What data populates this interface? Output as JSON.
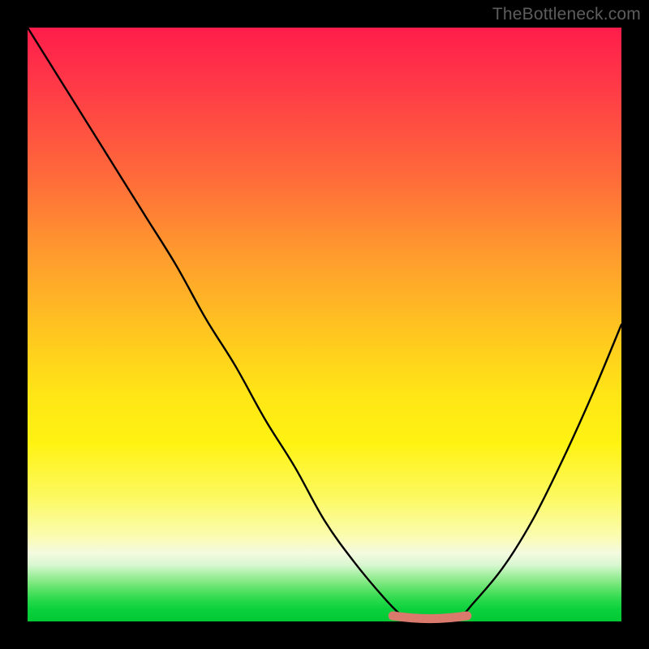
{
  "watermark": "TheBottleneck.com",
  "colors": {
    "frame": "#000000",
    "curve": "#000000",
    "marker": "#d97a6d",
    "gradient_top": "#ff1d4b",
    "gradient_bottom": "#00c934"
  },
  "chart_data": {
    "type": "line",
    "title": "",
    "xlabel": "",
    "ylabel": "",
    "xlim": [
      0,
      100
    ],
    "ylim": [
      0,
      100
    ],
    "series": [
      {
        "name": "bottleneck-curve",
        "x": [
          0,
          5,
          10,
          15,
          20,
          25,
          30,
          35,
          40,
          45,
          50,
          55,
          60,
          63,
          65,
          67,
          70,
          73,
          75,
          80,
          85,
          90,
          95,
          100
        ],
        "values": [
          100,
          92,
          84,
          76,
          68,
          60,
          51,
          43,
          34,
          26,
          17,
          10,
          4,
          1,
          0,
          0,
          0,
          1,
          3,
          9,
          17,
          27,
          38,
          50
        ]
      }
    ],
    "flat_minimum_segment": {
      "x_start": 61.5,
      "x_end": 74,
      "y": 0.8
    },
    "annotations": []
  }
}
